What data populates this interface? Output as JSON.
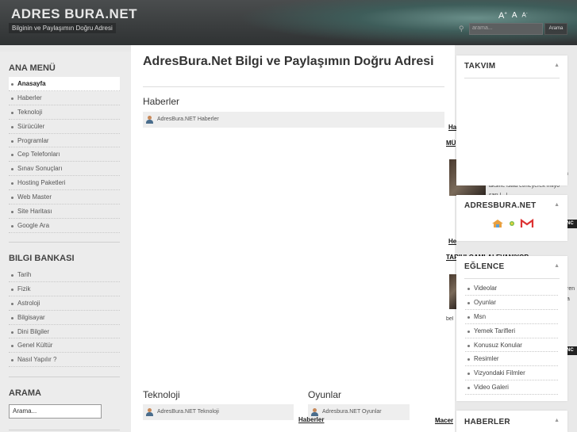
{
  "header": {
    "logo": "ADRES BURA.NET",
    "tagline": "Bilginin ve Paylaşımın Doğru Adresi",
    "font_big": "A",
    "font_mid": "A",
    "font_small": "A",
    "search_placeholder": "arama...",
    "search_button": "Arama"
  },
  "sidebar": {
    "menu_title": "ANA MENÜ",
    "menu_items": [
      "Anasayfa",
      "Haberler",
      "Teknoloji",
      "Sürücüler",
      "Programlar",
      "Cep Telefonları",
      "Sınav Sonuçları",
      "Hosting Paketleri",
      "Web Master",
      "Site Haritası",
      "Google Ara"
    ],
    "bank_title": "BILGI BANKASI",
    "bank_items": [
      "Tarih",
      "Fizik",
      "Astroloji",
      "Bilgisayar",
      "Dini Bilgiler",
      "Genel Kültür",
      "Nasıl Yapılır ?"
    ],
    "search_title": "ARAMA",
    "search_value": "Arama..."
  },
  "main": {
    "title": "AdresBura.Net Bilgi ve Paylaşımın Doğru Adresi",
    "news_heading": "Haberler",
    "news_bar": "AdresBura.NET Haberler",
    "tech_heading": "Teknoloji",
    "tech_bar": "AdresBura.NET Teknoloji",
    "fun_heading": "Oyunlar",
    "fun_bar": "Adresbura.NET Oyunlar",
    "haberler_link": "Haberler"
  },
  "peek": {
    "ha1": "Ha",
    "mu": "MÜ",
    "a1": "n",
    "a2": "aksine istila etmeyerek milyo",
    "a3": "sarı [...]",
    "nc1": "NC",
    "he2": "He",
    "tar": "TARIHLOAMLALEVANIYOR",
    "ren": "ren",
    "sa": "a",
    "bel": "bel",
    "nc2": "NC",
    "macer": "Macer"
  },
  "right": {
    "takvim": "TAKVIM",
    "adresbura": "ADRESBURA.NET",
    "eglence": "EĞLENCE",
    "haberler": "HABERLER",
    "eglence_items": [
      "Videolar",
      "Oyunlar",
      "Msn",
      "Yemek Tarifleri",
      "Konusuz Konular",
      "Resimler",
      "Vizyondaki Filmler",
      "Video Galeri"
    ]
  }
}
